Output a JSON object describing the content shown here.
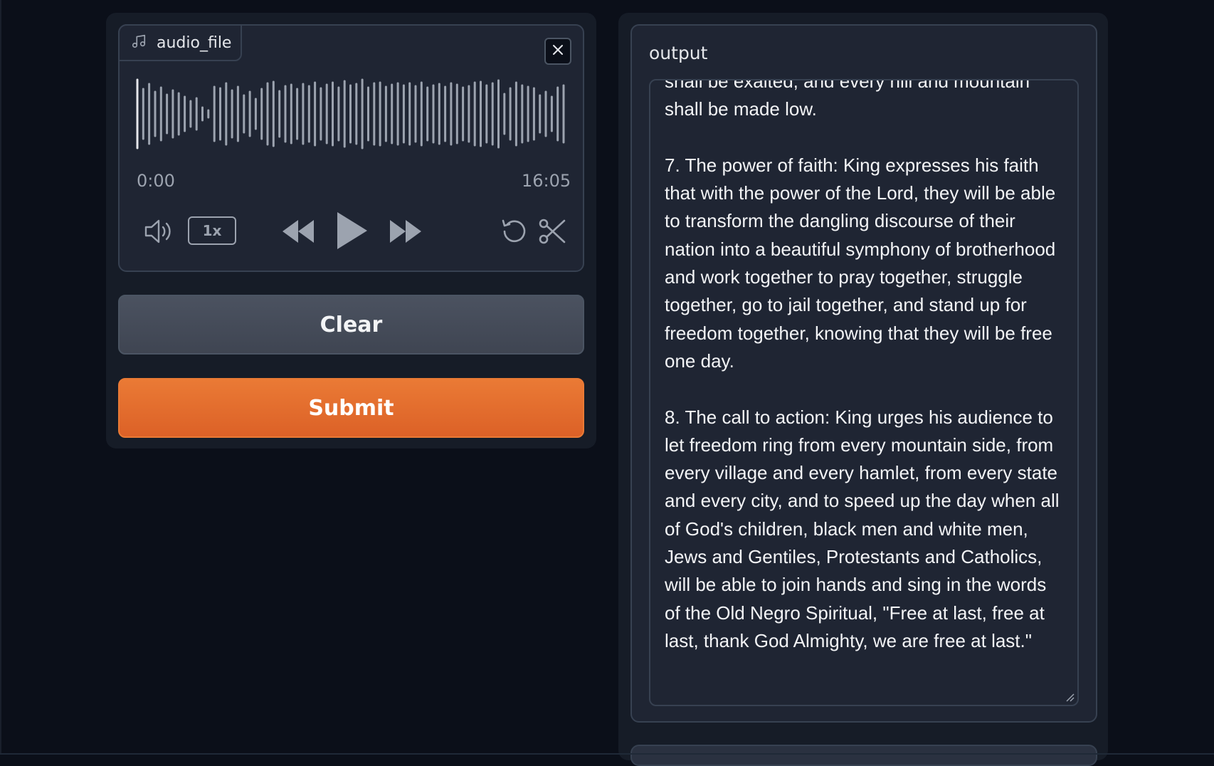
{
  "audio": {
    "label": "audio_file",
    "icon": "music-note-icon",
    "time_current": "0:00",
    "time_total": "16:05",
    "playback_speed": "1x"
  },
  "buttons": {
    "clear_label": "Clear",
    "submit_label": "Submit"
  },
  "output": {
    "label": "output",
    "text": "shall be exalted, and every hill and mountain shall be made low.\n\n7. The power of faith: King expresses his faith that with the power of the Lord, they will be able to transform the dangling discourse of their nation into a beautiful symphony of brotherhood and work together to pray together, struggle together, go to jail together, and stand up for freedom together, knowing that they will be free one day.\n\n8. The call to action: King urges his audience to let freedom ring from every mountain side, from every village and every hamlet, from every state and every city, and to speed up the day when all of God's children, black men and white men, Jews and Gentiles, Protestants and Catholics, will be able to join hands and sing in the words of the Old Negro Spiritual, \"Free at last, free at last, thank God Almighty, we are free at last.\""
  },
  "colors": {
    "background": "#0b0f19",
    "panel": "#161c27",
    "block": "#1f2533",
    "border": "#374151",
    "accent_orange": "#e8702e",
    "secondary_button": "#454b58"
  }
}
